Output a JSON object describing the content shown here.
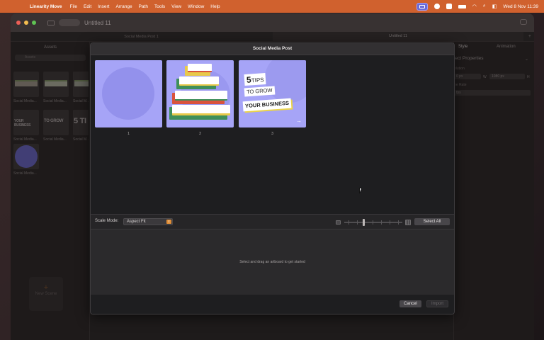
{
  "menubar": {
    "app_name": "Linearity Move",
    "items": [
      "File",
      "Edit",
      "Insert",
      "Arrange",
      "Path",
      "Tools",
      "View",
      "Window",
      "Help"
    ],
    "clock": "Wed 8 Nov  11:39",
    "icons": [
      "apple-icon",
      "screen-share-icon",
      "record-icon",
      "x-icon",
      "battery-icon",
      "wifi-icon",
      "search-icon",
      "control-center-icon"
    ]
  },
  "window": {
    "title": "Untitled 11",
    "tabs": [
      "Social Media Post 1",
      "Untitled 11"
    ]
  },
  "sidebar": {
    "title": "Assets",
    "search_placeholder": "Assets",
    "items": [
      {
        "caption": "Social Media..."
      },
      {
        "caption": "Social Media..."
      },
      {
        "caption": "Social M..."
      },
      {
        "caption": "Social Media..."
      },
      {
        "caption": "Social Media..."
      },
      {
        "caption": "Social M..."
      },
      {
        "caption": "Social Media..."
      }
    ],
    "thumb_words": [
      "YOUR BUSINESS",
      "TO GROW",
      "5 TI"
    ],
    "new_scene_label": "New Scene"
  },
  "inspector": {
    "tabs": [
      "Style",
      "Animation"
    ],
    "section_title": "ject Properties",
    "resolution_label": "olution",
    "width_value": "0 px",
    "w_label": "W",
    "height_value": "1080 px",
    "h_label": "H",
    "frame_rate_label": "ne Rate",
    "frame_rate_value": "fps"
  },
  "modal": {
    "title": "Social Media Post",
    "artboards": [
      {
        "number": "1"
      },
      {
        "number": "2"
      },
      {
        "number": "3",
        "line1_num": "5",
        "line1": "TIPS",
        "line2": "TO GROW",
        "line3": "YOUR BUSINESS",
        "arrow": "→"
      }
    ],
    "scale_mode_label": "Scale Mode:",
    "scale_mode_value": "Aspect Fit",
    "select_all_label": "Select All",
    "drop_hint": "Select and drag an artboard to get started",
    "cancel_label": "Cancel",
    "import_label": "Import",
    "colors": {
      "artboard_bg": "#a6a4f7",
      "accent": "#e08d36",
      "menubar": "#d0612e"
    }
  }
}
